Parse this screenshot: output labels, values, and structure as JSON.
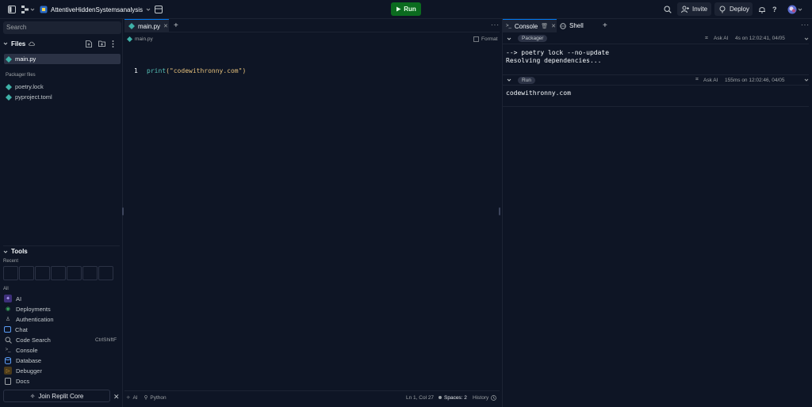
{
  "topbar": {
    "project_name": "AttentiveHiddenSystemsanalysis",
    "run_label": "Run",
    "invite_label": "Invite",
    "deploy_label": "Deploy"
  },
  "sidebar": {
    "search_placeholder": "Search",
    "files_title": "Files",
    "files": [
      {
        "name": "main.py"
      }
    ],
    "packager_label": "Packager files",
    "packager_files": [
      {
        "name": "poetry.lock"
      },
      {
        "name": "pyproject.toml"
      }
    ],
    "tools_title": "Tools",
    "recent_label": "Recent",
    "all_label": "All",
    "tools": [
      {
        "label": "AI",
        "icon": "ai-icon",
        "color": "#7c5cff"
      },
      {
        "label": "Deployments",
        "icon": "deployments-icon",
        "color": "#3aa55d"
      },
      {
        "label": "Authentication",
        "icon": "authentication-icon",
        "color": "#9da2a6"
      },
      {
        "label": "Chat",
        "icon": "chat-icon",
        "color": "#5b9cf5"
      },
      {
        "label": "Code Search",
        "icon": "code-search-icon",
        "color": "#9da2a6",
        "shortcut": "CtrlShiftF"
      },
      {
        "label": "Console",
        "icon": "console-icon",
        "color": "#9da2a6"
      },
      {
        "label": "Database",
        "icon": "database-icon",
        "color": "#5b9cf5"
      },
      {
        "label": "Debugger",
        "icon": "debugger-icon",
        "color": "#e0a33c"
      },
      {
        "label": "Docs",
        "icon": "docs-icon",
        "color": "#9da2a6"
      }
    ],
    "join_label": "Join Replit Core"
  },
  "editor": {
    "tab_label": "main.py",
    "breadcrumb": "main.py",
    "format_label": "Format",
    "line_number": "1",
    "code_func": "print",
    "code_open": "(",
    "code_string": "\"codewithronny.com\"",
    "code_close": ")",
    "status": {
      "ai": "AI",
      "language": "Python",
      "position": "Ln 1, Col 27",
      "spaces": "Spaces: 2",
      "history": "History"
    }
  },
  "console": {
    "tab_console": "Console",
    "tab_shell": "Shell",
    "blocks": [
      {
        "badge": "Packager",
        "ask_ai": "Ask AI",
        "meta": "4s on 12:02:41, 04/05",
        "lines": [
          "--> poetry lock --no-update",
          "Resolving dependencies..."
        ]
      },
      {
        "badge": "Run",
        "ask_ai": "Ask AI",
        "meta": "155ms on 12:02:46, 04/05",
        "lines": [
          "codewithronny.com"
        ]
      }
    ]
  },
  "colors": {
    "background": "#0e1525",
    "panel": "#1c2333",
    "run_green": "#0b6b1f",
    "accent_blue": "#0079f2",
    "python_teal": "#3fb1a8",
    "string_yellow": "#e5c07b",
    "func_teal": "#56c2b8"
  }
}
